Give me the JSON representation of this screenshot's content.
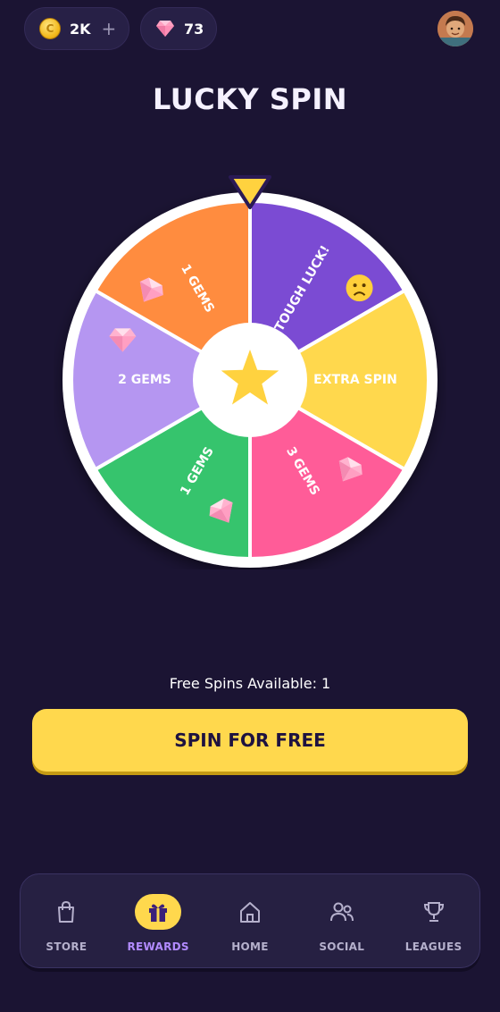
{
  "header": {
    "coins_value": "2K",
    "coin_symbol": "C",
    "plus_label": "+",
    "gems_value": "73"
  },
  "title": "LUCKY SPIN",
  "wheel": {
    "segments": [
      {
        "label": "TOUGH LUCK!",
        "color": "#7b4bd3",
        "icon": "sad-face-icon"
      },
      {
        "label": "EXTRA SPIN",
        "color": "#ffd84d",
        "icon": ""
      },
      {
        "label": "3 GEMS",
        "color": "#ff5c98",
        "icon": "gem-icon"
      },
      {
        "label": "1 GEMS",
        "color": "#36c46d",
        "icon": "gem-icon"
      },
      {
        "label": "2 GEMS",
        "color": "#b596f1",
        "icon": "gem-icon"
      },
      {
        "label": "1 GEMS",
        "color": "#ff8c3f",
        "icon": "gem-icon"
      }
    ],
    "center_icon": "star-icon"
  },
  "free_spins_text": "Free Spins Available: 1",
  "spin_button_label": "SPIN FOR FREE",
  "nav": {
    "items": [
      {
        "label": "STORE",
        "icon": "bag-icon",
        "active": false
      },
      {
        "label": "REWARDS",
        "icon": "gift-icon",
        "active": true
      },
      {
        "label": "HOME",
        "icon": "home-icon",
        "active": false
      },
      {
        "label": "SOCIAL",
        "icon": "people-icon",
        "active": false
      },
      {
        "label": "LEAGUES",
        "icon": "trophy-icon",
        "active": false
      }
    ]
  },
  "colors": {
    "background": "#1b1433",
    "accent_yellow": "#ffd84d",
    "active_nav_label": "#b28bff"
  }
}
